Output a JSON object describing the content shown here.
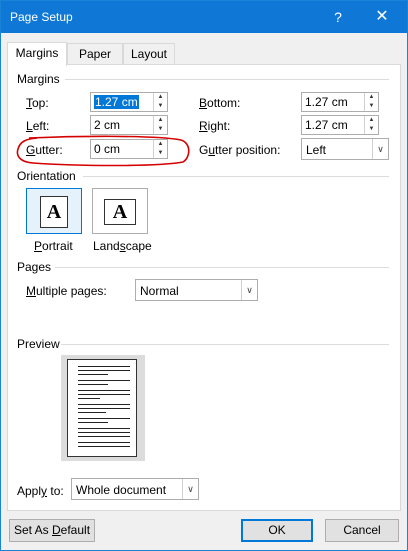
{
  "window": {
    "title": "Page Setup",
    "help_glyph": "?",
    "close_glyph": "✕"
  },
  "tabs": [
    {
      "label": "Margins",
      "active": true
    },
    {
      "label": "Paper",
      "active": false
    },
    {
      "label": "Layout",
      "active": false
    }
  ],
  "margins": {
    "group_label": "Margins",
    "top": {
      "label_u": "T",
      "label_rest": "op:",
      "value": "1.27 cm"
    },
    "left": {
      "label_u": "L",
      "label_rest": "eft:",
      "value": "2 cm"
    },
    "gutter": {
      "label_u": "G",
      "label_rest": "utter:",
      "value": "0 cm"
    },
    "bottom": {
      "label_u": "B",
      "label_rest": "ottom:",
      "value": "1.27 cm"
    },
    "right": {
      "label_u": "R",
      "label_rest": "ight:",
      "value": "1.27 cm"
    },
    "gutter_position": {
      "label_pre": "G",
      "label_u": "u",
      "label_rest": "tter position:",
      "value": "Left"
    }
  },
  "orientation": {
    "group_label": "Orientation",
    "portrait": {
      "label_u": "P",
      "label_rest": "ortrait",
      "glyph": "A",
      "selected": true
    },
    "landscape": {
      "label_pre": "Land",
      "label_u": "s",
      "label_rest": "cape",
      "glyph": "A",
      "selected": false
    }
  },
  "pages": {
    "group_label": "Pages",
    "multiple_pages": {
      "label_u": "M",
      "label_rest": "ultiple pages:",
      "value": "Normal"
    }
  },
  "preview": {
    "group_label": "Preview"
  },
  "apply_to": {
    "label_pre": "Appl",
    "label_u": "y",
    "label_rest": " to:",
    "value": "Whole document"
  },
  "buttons": {
    "set_default": {
      "label_pre": "Set As ",
      "label_u": "D",
      "label_rest": "efault"
    },
    "ok": "OK",
    "cancel": "Cancel"
  },
  "colors": {
    "accent": "#0078d7",
    "titlebar": "#0f78d7",
    "annotation": "#d40000"
  },
  "icons": {
    "spin_up": "▲",
    "spin_down": "▼",
    "combo_arrow": "∨"
  }
}
